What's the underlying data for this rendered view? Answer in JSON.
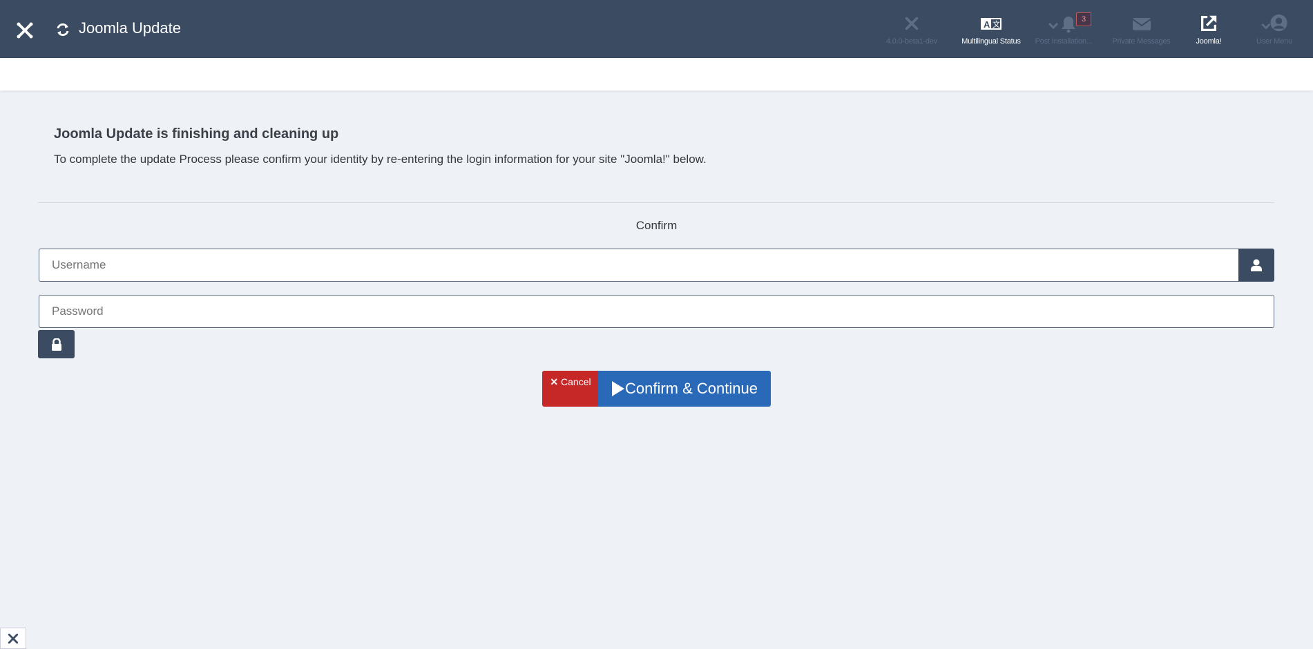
{
  "header": {
    "app_title": "Joomla Update",
    "items": [
      {
        "label": "4.0.0-beta1-dev",
        "icon": "joomla-icon"
      },
      {
        "label": "Multilingual Status",
        "icon": "language-icon"
      },
      {
        "label": "Post Installation...",
        "icon": "bell-icon",
        "badge": "3"
      },
      {
        "label": "Private Messages",
        "icon": "envelope-icon"
      },
      {
        "label": "Joomla!",
        "icon": "external-link-icon"
      },
      {
        "label": "User Menu",
        "icon": "user-circle-icon"
      }
    ]
  },
  "main": {
    "heading": "Joomla Update is finishing and cleaning up",
    "description": "To complete the update Process please confirm your identity by re-entering the login information for your site \"Joomla!\" below.",
    "legend": "Confirm",
    "username_placeholder": "Username",
    "password_placeholder": "Password",
    "cancel_label": "Cancel",
    "confirm_label": "Confirm & Continue"
  },
  "colors": {
    "header_bg": "#3b4b61",
    "cancel": "#c52827",
    "confirm": "#2a69b8"
  }
}
